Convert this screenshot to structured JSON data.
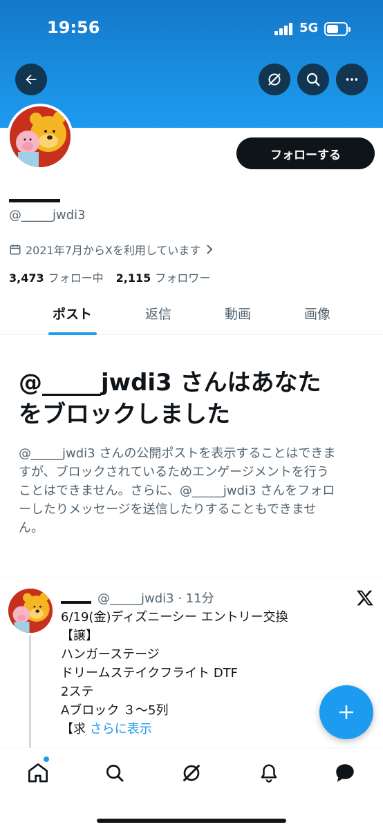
{
  "status_bar": {
    "time": "19:56",
    "network": "5G"
  },
  "header": {
    "back_icon": "arrow-left-icon",
    "grok_icon": "grok-icon",
    "search_icon": "search-icon",
    "more_icon": "more-icon"
  },
  "profile": {
    "handle": "@_____jwdi3",
    "joined": "2021年7月からXを利用しています",
    "following_count": "3,473",
    "following_label": "フォロー中",
    "followers_count": "2,115",
    "followers_label": "フォロワー",
    "follow_button": "フォローする"
  },
  "tabs": [
    {
      "label": "ポスト",
      "active": true
    },
    {
      "label": "返信",
      "active": false
    },
    {
      "label": "動画",
      "active": false
    },
    {
      "label": "画像",
      "active": false
    }
  ],
  "blocked": {
    "title_line1": "@_____jwdi3 さんはあなた",
    "title_line2": "をブロックしました",
    "desc_line1": "@_____jwdi3 さんの公開ポストを表示することはできま",
    "desc_line2": "すが、ブロックされているためエンゲージメントを行う",
    "desc_line3": "ことはできません。さらに、@_____jwdi3 さんをフォロ",
    "desc_line4": "ーしたりメッセージを送信したりすることもできませ",
    "desc_line5": "ん。"
  },
  "tweet": {
    "meta": "@_____jwdi3 · 11分",
    "lines": [
      "6/19(金)ディズニーシー エントリー交換",
      "【譲】",
      "ハンガーステージ",
      "ドリームステイクフライト DTF",
      "2ステ",
      "Aブロック ３～5列"
    ],
    "last_line": "【求",
    "show_more": "さらに表示"
  },
  "colors": {
    "accent": "#1d9bf0",
    "text": "#0f1419",
    "muted": "#536471",
    "banner": "#1a8ee0"
  }
}
